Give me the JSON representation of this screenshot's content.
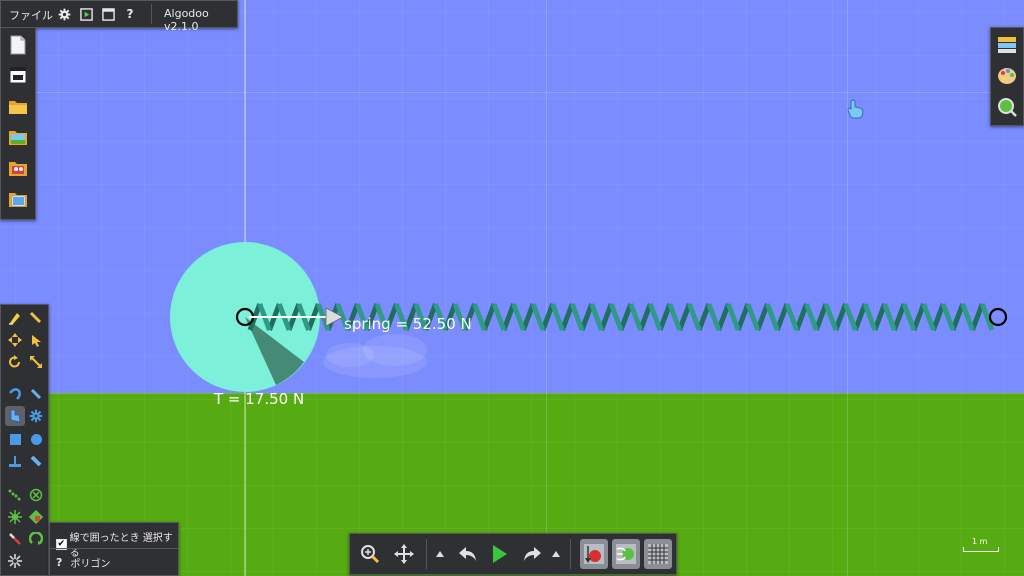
{
  "app": {
    "title": "Algodoo v2.1.0",
    "file_menu_label": "ファイル"
  },
  "scene": {
    "spring_label": "spring = 52.50 N",
    "tension_label": "T = 17.50 N",
    "scale_label": "1 m",
    "colors": {
      "sky": "#7b8dfe",
      "ground": "#57ab12",
      "circle": "#7cf0d8",
      "spring": "#2f9a86",
      "wedge": "#3f7e6c"
    }
  },
  "tool_options": {
    "select_on_enclose_label": "線で囲ったとき 選択する",
    "select_on_enclose_checked": true,
    "help_icon": "?",
    "polygon_label": "ポリゴン"
  },
  "top_bar": {
    "help_icon": "?"
  },
  "icons": {
    "top_bar": [
      "gear-icon",
      "play-window-icon",
      "window-icon",
      "help-icon"
    ],
    "left_file_panel": [
      "new-scene-icon",
      "window-icon",
      "open-folder-icon",
      "scene-browser-icon",
      "phunlets-icon",
      "image-folder-icon"
    ],
    "left_tool_panel": [
      "sketch-tool-icon",
      "brush-tool-icon",
      "move-tool-icon",
      "drag-tool-icon",
      "rotate-tool-icon",
      "scale-tool-icon",
      "rope-tool-icon",
      "knife-tool-icon",
      "polygon-tool-icon",
      "gear-tool-icon",
      "box-tool-icon",
      "circle-tool-icon",
      "plane-tool-icon",
      "cut-tool-icon",
      "chain-tool-icon",
      "axle-tool-icon",
      "spring-tool-icon",
      "fixate-tool-icon",
      "laser-tool-icon",
      "thruster-tool-icon",
      "tracer-tool-icon"
    ],
    "right_panel": [
      "layers-icon",
      "palette-icon",
      "inspector-icon"
    ],
    "bottom_bar": [
      "zoom-icon",
      "pan-icon",
      "undo-menu-arrow-icon",
      "undo-icon",
      "play-icon",
      "redo-icon",
      "redo-menu-arrow-icon",
      "gravity-icon",
      "air-friction-icon",
      "grid-icon"
    ]
  }
}
